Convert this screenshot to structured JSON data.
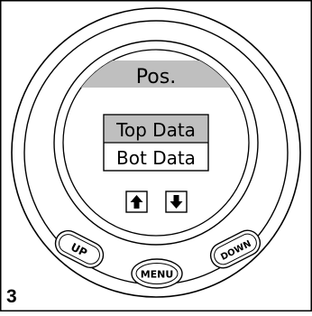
{
  "figure_number": "3",
  "display": {
    "header": "Pos.",
    "menu_items": [
      "Top Data",
      "Bot Data"
    ],
    "selected_index": 0,
    "arrow_up_icon": "arrow-up-icon",
    "arrow_down_icon": "arrow-down-icon"
  },
  "buttons": {
    "up": "UP",
    "menu": "MENU",
    "down": "DOWN"
  },
  "colors": {
    "header_bar": "#bfbfbf",
    "selected_row": "#bfbfbf",
    "stroke": "#000000"
  }
}
